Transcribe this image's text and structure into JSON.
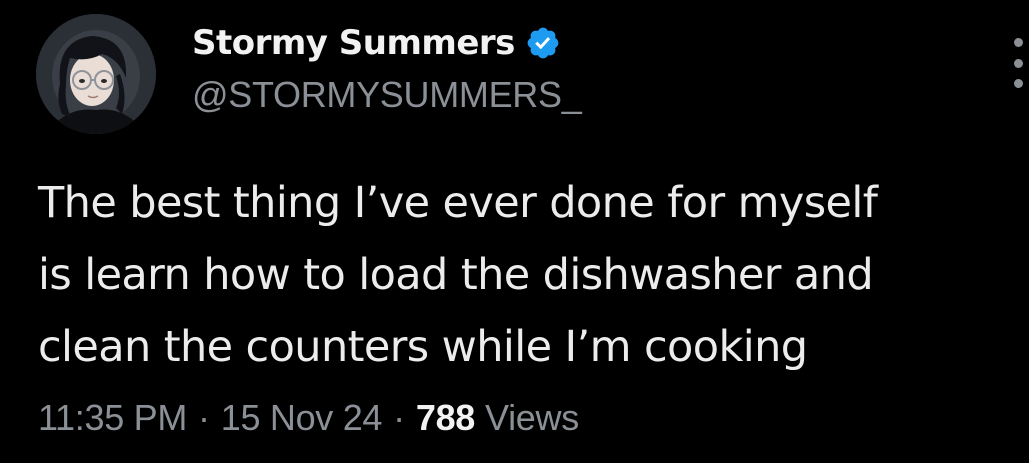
{
  "author": {
    "display_name": "Stormy Summers",
    "handle": "@STORMYSUMMERS_",
    "verified": true
  },
  "tweet": {
    "text_lines": [
      "The best thing I’ve ever done for myself",
      "is learn how to load the dishwasher and",
      "clean the counters while I’m cooking"
    ]
  },
  "meta": {
    "time": "11:35 PM",
    "separator": "·",
    "date": "15 Nov 24",
    "views_count": "788",
    "views_label": "Views"
  },
  "icons": {
    "verified": "verified-badge-icon",
    "more": "more-options-icon"
  },
  "colors": {
    "background": "#000000",
    "primary_text": "#e7e9ea",
    "secondary_text": "#8b9096",
    "verified_blue": "#1d9bf0"
  }
}
